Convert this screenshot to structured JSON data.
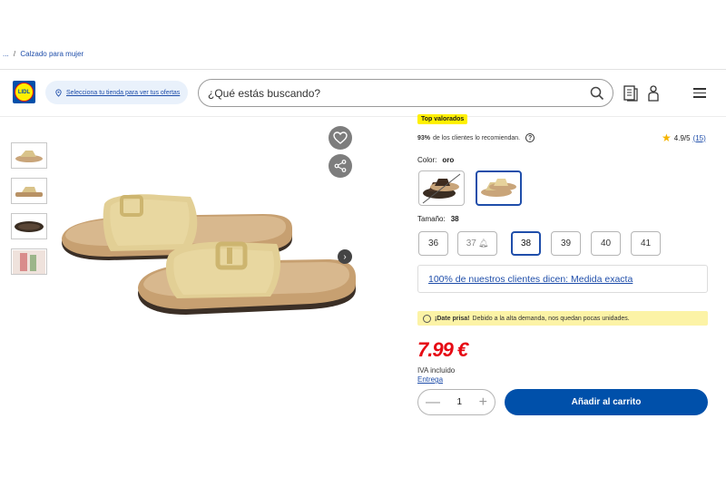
{
  "breadcrumb": {
    "ellipsis": "...",
    "separator": "/",
    "current": "Calzado para mujer"
  },
  "header": {
    "logo_text": "LIDL",
    "store_selector": "Selecciona tu tienda para ver tus ofertas",
    "search_placeholder": "¿Qué estás buscando?",
    "icons": [
      "search-icon",
      "shopping-list-icon",
      "account-icon",
      "menu-icon"
    ]
  },
  "product": {
    "badge": "Top valorados",
    "recommend_pct": "93%",
    "recommend_text": "de los clientes lo recomiendan.",
    "rating": "4.9/5",
    "review_count": "(15)",
    "color_label": "Color:",
    "color_value": "oro",
    "size_label": "Tamaño:",
    "size_value": "38",
    "sizes": [
      "36",
      "37",
      "38",
      "39",
      "40",
      "41"
    ],
    "selected_size": "38",
    "unavailable_size": "37",
    "fit_text": "100% de nuestros clientes dicen: Medida exacta",
    "hurry_bold": "¡Date prisa!",
    "hurry_text": "Debido a la alta demanda, nos quedan pocas unidades.",
    "price": "7.99 €",
    "iva": "IVA incluido",
    "delivery": "Entrega",
    "quantity": "1",
    "qty_minus": "—",
    "qty_plus": "+",
    "add_to_cart": "Añadir al carrito"
  },
  "colors": {
    "brand_blue": "#0050aa",
    "price_red": "#e60a14",
    "badge_yellow": "#fff000",
    "hurry_yellow": "#fcf3a6"
  }
}
